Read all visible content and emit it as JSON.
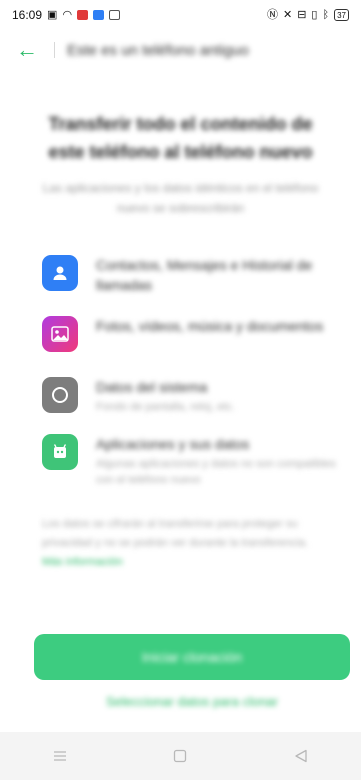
{
  "status_bar": {
    "time": "16:09",
    "battery": "37"
  },
  "header": {
    "title": "Este es un teléfono antiguo"
  },
  "main": {
    "title": "Transferir todo el contenido de este teléfono al teléfono nuevo",
    "subtitle": "Las aplicaciones y los datos idénticos en el teléfono nuevo se sobrescribirán",
    "items": [
      {
        "label": "Contactos, Mensajes e Historial de llamadas",
        "sub": "",
        "icon": "contacts-icon",
        "color": "#2f7ff5"
      },
      {
        "label": "Fotos, vídeos, música y documentos",
        "sub": "",
        "icon": "gallery-icon",
        "color": "#e8359c"
      },
      {
        "label": "Datos del sistema",
        "sub": "Fondo de pantalla, reloj, etc.",
        "icon": "system-data-icon",
        "color": "#7d7d7d"
      },
      {
        "label": "Aplicaciones y sus datos",
        "sub": "Algunas aplicaciones y datos no son compatibles con el teléfono nuevo",
        "icon": "apps-icon",
        "color": "#3fc478"
      }
    ],
    "note": "Los datos se cifrarán al transferirse para proteger su privacidad y no se podrán ver durante la transferencia.",
    "note_link": "Más información"
  },
  "footer": {
    "start_button": "Iniciar clonación",
    "bottom_link": "Seleccionar datos para clonar"
  },
  "colors": {
    "accent": "#2dbb6a",
    "button": "#3dcc80"
  }
}
